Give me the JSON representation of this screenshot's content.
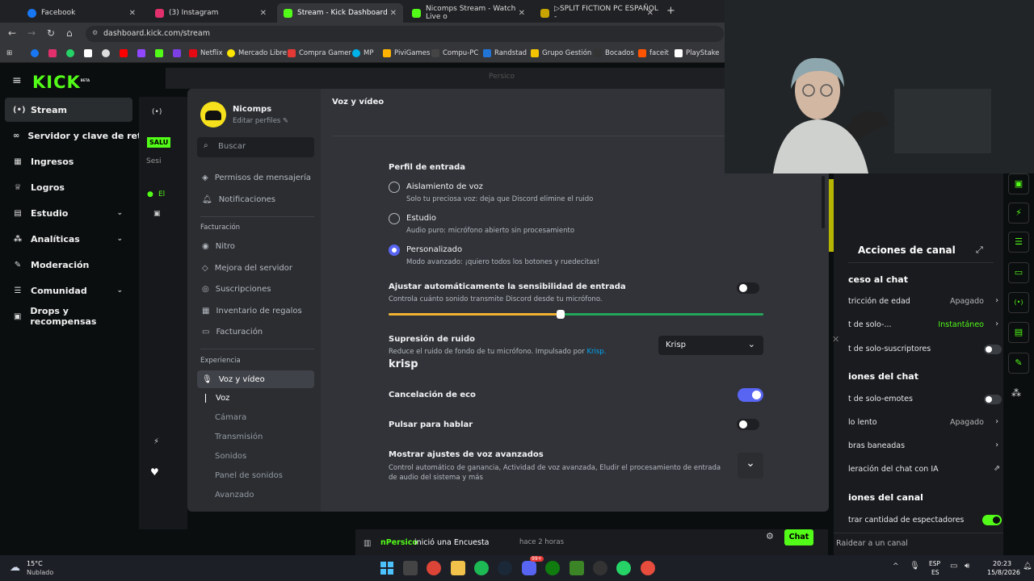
{
  "browser": {
    "tabs": [
      {
        "label": "Facebook",
        "color": "#1877f2"
      },
      {
        "label": "(3) Instagram",
        "color": "#e1306c"
      },
      {
        "label": "Stream - Kick Dashboard",
        "color": "#53fc18"
      },
      {
        "label": "Nicomps Stream - Watch Live o",
        "color": "#53fc18"
      },
      {
        "label": "▷SPLIT FICTION PC ESPAÑOL -",
        "color": "#c8a400"
      }
    ],
    "url": "dashboard.kick.com/stream",
    "bookmarks": [
      "Netflix",
      "Mercado Libre",
      "Compra Gamer",
      "MP",
      "PiviGames",
      "Compu-PC",
      "Randstad",
      "Grupo Gestión",
      "Bocados",
      "faceit",
      "PlayStake"
    ]
  },
  "kick": {
    "logo": "KICK",
    "beta": "BETA",
    "menu": [
      {
        "label": "Stream",
        "icon": "broadcast-icon",
        "active": true
      },
      {
        "label": "Servidor y clave de retrans",
        "icon": "link-icon"
      },
      {
        "label": "Ingresos",
        "icon": "chart-icon"
      },
      {
        "label": "Logros",
        "icon": "trophy-icon"
      },
      {
        "label": "Estudio",
        "icon": "studio-icon",
        "chevron": true
      },
      {
        "label": "Analíticas",
        "icon": "analytics-icon",
        "chevron": true
      },
      {
        "label": "Moderación",
        "icon": "wrench-icon"
      },
      {
        "label": "Comunidad",
        "icon": "community-icon",
        "chevron": true
      },
      {
        "label": "Drops y recompensas",
        "icon": "gift-icon"
      }
    ],
    "sal_badge": "SALU",
    "ses_text": "Sesi",
    "el_text": "El",
    "persico_label": "Persico"
  },
  "discord": {
    "user": {
      "name": "Nicomps",
      "edit_label": "Editar perfiles"
    },
    "search_placeholder": "Buscar",
    "items_top": [
      "Permisos de mensajería",
      "Notificaciones"
    ],
    "section_billing": "Facturación",
    "billing_items": [
      "Nitro",
      "Mejora del servidor",
      "Suscripciones",
      "Inventario de regalos",
      "Facturación"
    ],
    "section_experience": "Experiencia",
    "experience_active": "Voz y vídeo",
    "sub_items": [
      "Voz",
      "Cámara",
      "Transmisión",
      "Sonidos",
      "Panel de sonidos",
      "Avanzado"
    ],
    "page_title": "Voz y vídeo",
    "input_profile_title": "Perfil de entrada",
    "profiles": [
      {
        "title": "Aislamiento de voz",
        "desc": "Solo tu preciosa voz: deja que Discord elimine el ruido",
        "selected": false
      },
      {
        "title": "Estudio",
        "desc": "Audio puro: micrófono abierto sin procesamiento",
        "selected": false
      },
      {
        "title": "Personalizado",
        "desc": "Modo avanzado: ¡quiero todos los botones y ruedecitas!",
        "selected": true
      }
    ],
    "auto_sens": {
      "title": "Ajustar automáticamente la sensibilidad de entrada",
      "desc": "Controla cuánto sonido transmite Discord desde tu micrófono.",
      "on": false,
      "slider_value": 0.46
    },
    "noise": {
      "title": "Supresión de ruido",
      "desc": "Reduce el ruido de fondo de tu micrófono. Impulsado por ",
      "desc_link": "Krisp.",
      "select_value": "Krisp",
      "logo": "krisp"
    },
    "echo": {
      "title": "Cancelación de eco",
      "on": true
    },
    "ptt": {
      "title": "Pulsar para hablar",
      "on": false
    },
    "advanced": {
      "title": "Mostrar ajustes de voz avanzados",
      "desc": "Control automático de ganancia, Actividad de voz avanzada, Eludir el procesamiento de entrada de audio del sistema y más"
    }
  },
  "channel_actions": {
    "title": "Acciones de canal",
    "section_chat_access": "ceso al chat",
    "rows1": [
      {
        "label": "tricción de edad",
        "value": "Apagado",
        "type": "chevron"
      },
      {
        "label": "t de solo-...",
        "value": "Instantáneo",
        "type": "chevron",
        "value_color": "#53fc18"
      },
      {
        "label": "t de solo-suscriptores",
        "type": "toggle",
        "on": false
      }
    ],
    "section_chat": "iones del chat",
    "rows2": [
      {
        "label": "t de solo-emotes",
        "type": "toggle",
        "on": false
      },
      {
        "label": "lo lento",
        "value": "Apagado",
        "type": "chevron"
      },
      {
        "label": "bras baneadas",
        "type": "chevron"
      },
      {
        "label": "leración del chat con IA",
        "type": "external"
      }
    ],
    "section_channel": "iones del canal",
    "rows3": [
      {
        "label": "trar cantidad de espectadores",
        "type": "toggle",
        "on": true
      }
    ],
    "raid_label": "Raidear a un canal"
  },
  "chat": {
    "notice_user": "nPersico",
    "notice_text": "inició una Encuesta",
    "notice_time": "hace 2 horas",
    "chat_button": "Chat"
  },
  "taskbar": {
    "weather_temp": "15°C",
    "weather_desc": "Nublado",
    "lang": "ESP",
    "lang_sub": "ES",
    "time": "20:23",
    "date": "15/8/2026",
    "badge": "99+"
  }
}
